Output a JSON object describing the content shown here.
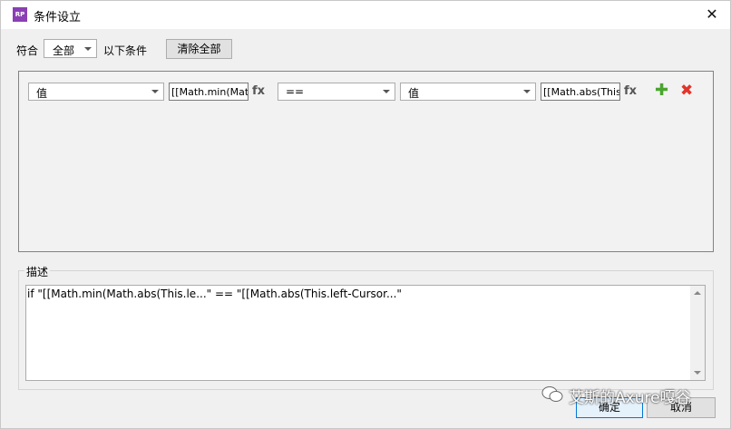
{
  "window": {
    "title": "条件设立",
    "app_icon_text": "RP"
  },
  "match": {
    "label": "符合",
    "selected": "全部",
    "suffix": "以下条件"
  },
  "toolbar": {
    "clear_all_label": "清除全部"
  },
  "condition": {
    "left_type": "值",
    "left_value": "[[Math.min(Math.a",
    "operator": "==",
    "right_type": "值",
    "right_value": "[[Math.abs(This.le",
    "fx_label": "fx"
  },
  "description": {
    "label": "描述",
    "text": "if \"[[Math.min(Math.abs(This.le...\" == \"[[Math.abs(This.left-Cursor...\""
  },
  "footer": {
    "ok_label": "确定",
    "cancel_label": "取消"
  },
  "watermark": {
    "text": "艾斯的Axure嘎谷"
  },
  "colors": {
    "add": "#4aa52e",
    "delete": "#e0352b",
    "focus": "#0078d7"
  }
}
